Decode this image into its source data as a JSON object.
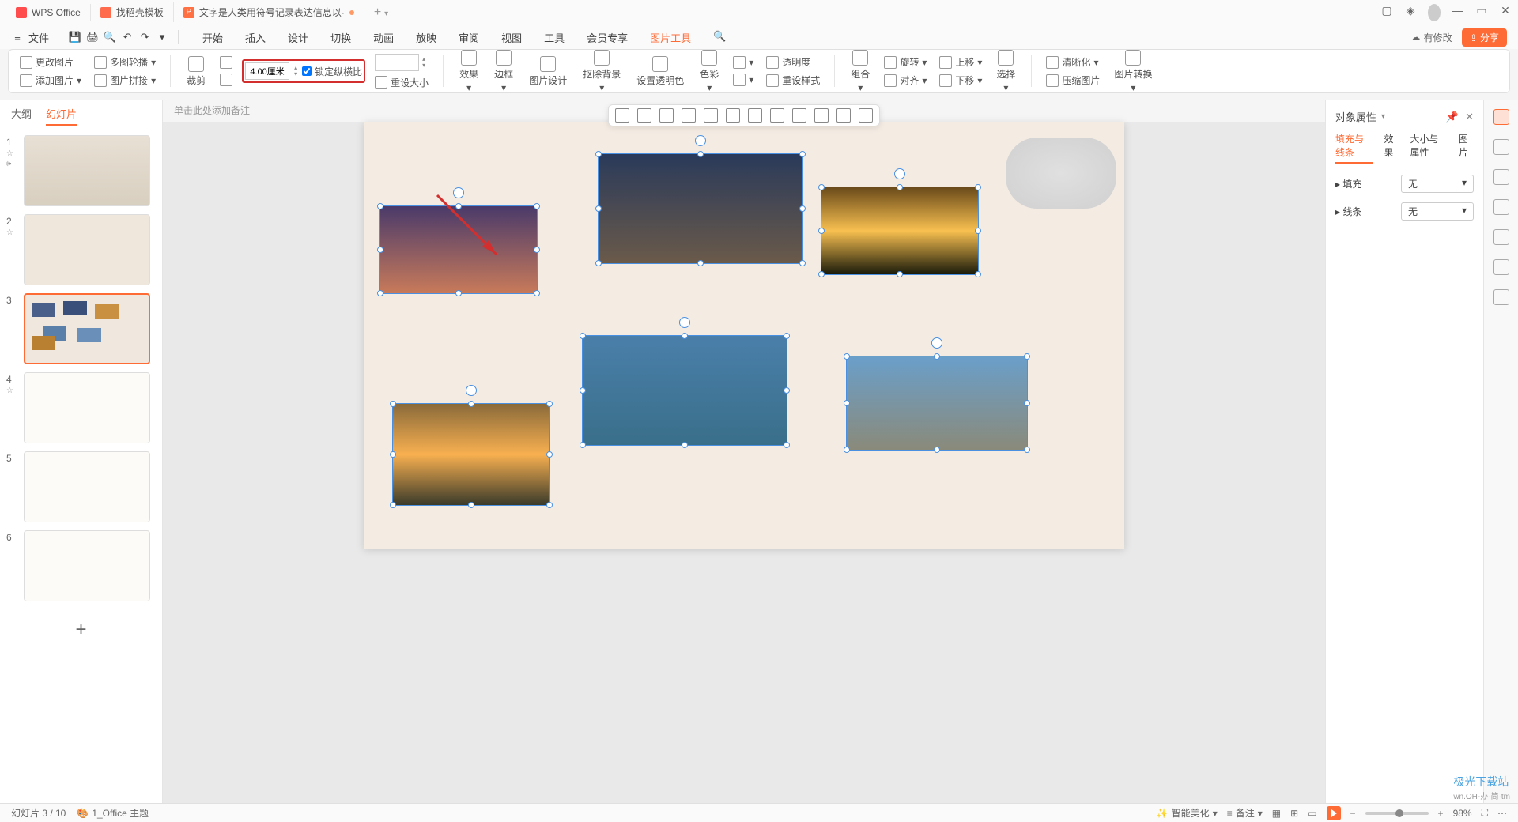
{
  "titlebar": {
    "tabs": [
      {
        "label": "WPS Office"
      },
      {
        "label": "找稻壳模板"
      },
      {
        "label": "文字是人类用符号记录表达信息以·"
      }
    ],
    "add": "+"
  },
  "menubar": {
    "file_label": "文件",
    "tabs": {
      "start": "开始",
      "insert": "插入",
      "design": "设计",
      "transition": "切换",
      "animation": "动画",
      "slideshow": "放映",
      "review": "审阅",
      "view": "视图",
      "tools": "工具",
      "member": "会员专享",
      "pictools": "图片工具"
    },
    "cloud_text": "有修改",
    "share": "分享"
  },
  "ribbon": {
    "change_pic": "更改图片",
    "multi_rotate": "多图轮播",
    "add_pic": "添加图片",
    "pic_join": "图片拼接",
    "crop": "裁剪",
    "size_value": "4.00厘米",
    "lock_ratio": "锁定纵横比",
    "reset_size": "重设大小",
    "effects": "效果",
    "border": "边框",
    "pic_design": "图片设计",
    "remove_bg": "抠除背景",
    "set_transparent": "设置透明色",
    "color": "色彩",
    "transparent": "透明度",
    "reset_style": "重设样式",
    "group": "组合",
    "rotate": "旋转",
    "align": "对齐",
    "up": "上移",
    "down": "下移",
    "select": "选择",
    "clarity": "清晰化",
    "compress": "压缩图片",
    "pic_convert": "图片转换"
  },
  "slidepanel": {
    "tabs": {
      "outline": "大纲",
      "slides": "幻灯片"
    },
    "thumbs": [
      "1",
      "2",
      "3",
      "4",
      "5",
      "6"
    ],
    "add": "+"
  },
  "canvas": {
    "notes_placeholder": "单击此处添加备注"
  },
  "prop": {
    "title": "对象属性",
    "tabs": {
      "fill": "填充与线条",
      "effect": "效果",
      "size": "大小与属性",
      "pic": "图片"
    },
    "fill_label": "填充",
    "fill_value": "无",
    "line_label": "线条",
    "line_value": "无"
  },
  "statusbar": {
    "slide_info": "幻灯片 3 / 10",
    "theme": "1_Office 主题",
    "beautify": "智能美化",
    "notesbtn": "备注",
    "zoom_pct": "98%"
  },
  "watermark": {
    "l1": "极光下载站",
    "l2": "wn.OH-办·简·tm"
  }
}
